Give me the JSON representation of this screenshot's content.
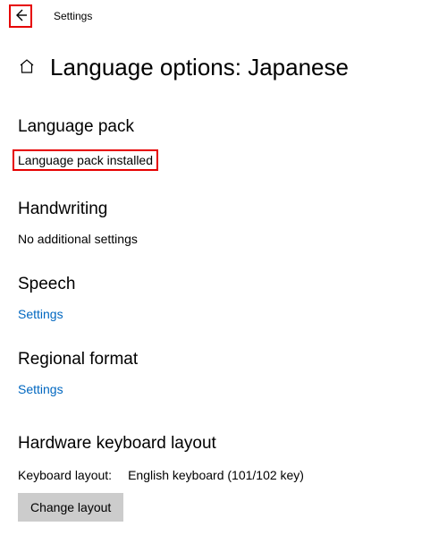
{
  "app": {
    "title": "Settings"
  },
  "page": {
    "title": "Language options: Japanese"
  },
  "sections": {
    "language_pack": {
      "heading": "Language pack",
      "status": "Language pack installed"
    },
    "handwriting": {
      "heading": "Handwriting",
      "status": "No additional settings"
    },
    "speech": {
      "heading": "Speech",
      "link": "Settings"
    },
    "regional_format": {
      "heading": "Regional format",
      "link": "Settings"
    },
    "hardware_keyboard": {
      "heading": "Hardware keyboard layout",
      "label": "Keyboard layout:",
      "value": "English keyboard (101/102 key)",
      "button": "Change layout"
    }
  }
}
